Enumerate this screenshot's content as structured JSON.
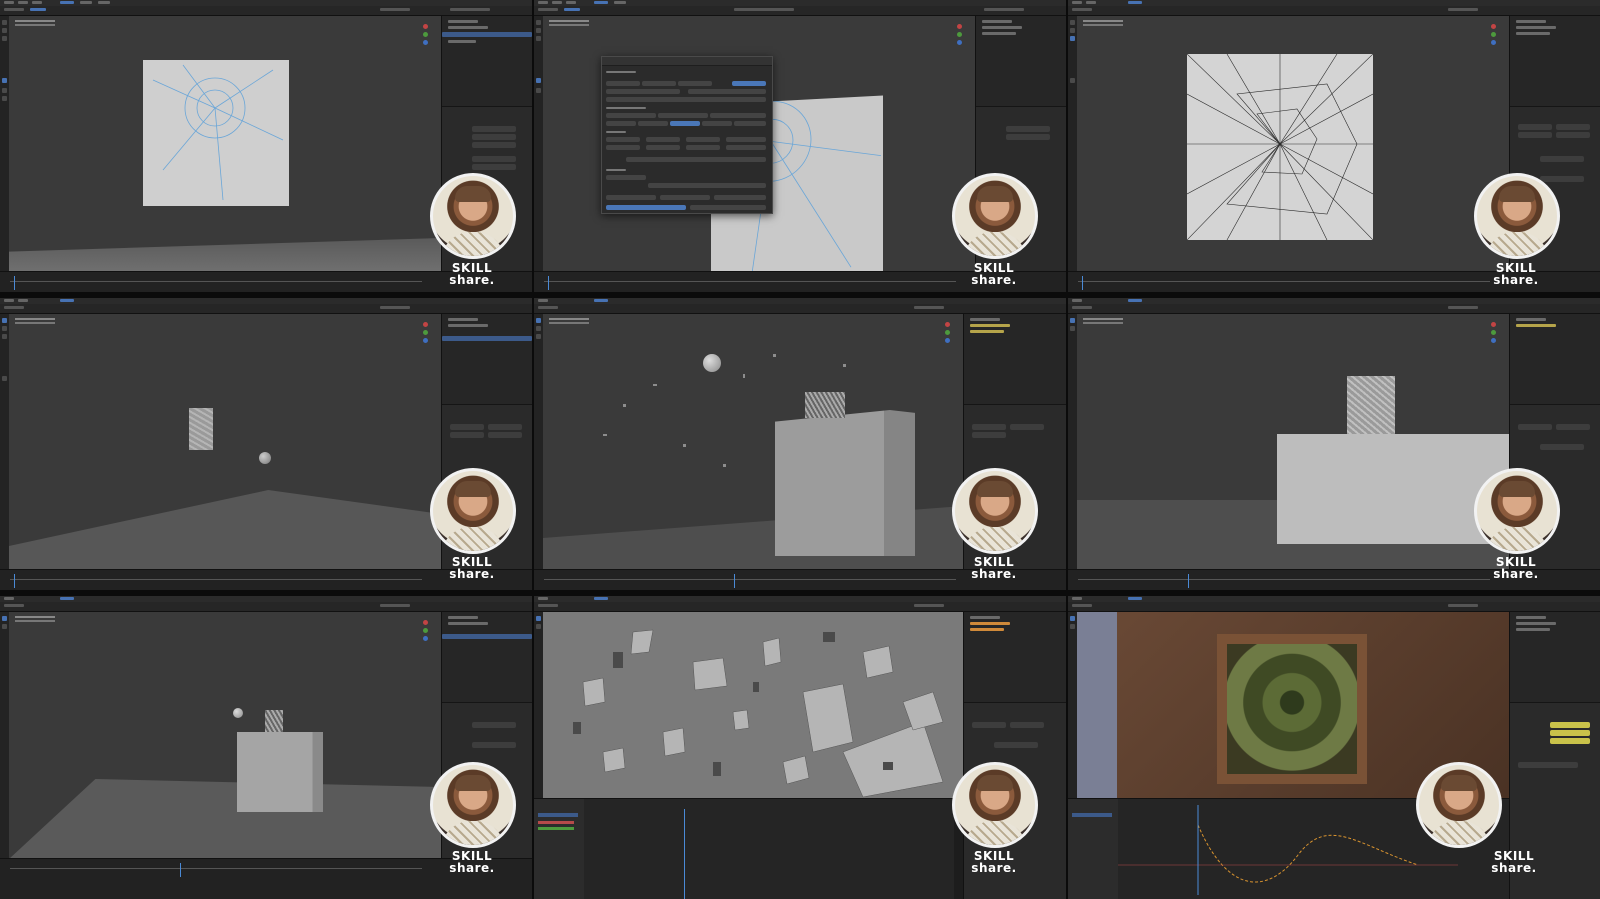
{
  "layout": {
    "columns": 3,
    "rows": 3
  },
  "brand": {
    "line1": "SKILL",
    "line2": "share."
  },
  "colors": {
    "viewport_bg": "#3a3a3a",
    "panel_bg": "#2a2a2a",
    "selection_blue": "#4772b3",
    "brand_text": "#ffffff",
    "avatar_ring": "#f2f2f2"
  },
  "tiles": [
    {
      "id": 1,
      "scene": "plane-with-blue-web-lines"
    },
    {
      "id": 2,
      "scene": "cell-fracture-dialog-over-plane"
    },
    {
      "id": 3,
      "scene": "plane-with-dense-fracture-lines"
    },
    {
      "id": 4,
      "scene": "small-panel-and-sphere-on-ground"
    },
    {
      "id": 5,
      "scene": "sphere-breaking-wall-debris"
    },
    {
      "id": 6,
      "scene": "fractured-panel-behind-wall"
    },
    {
      "id": 7,
      "scene": "debris-above-wall-wide-view"
    },
    {
      "id": 8,
      "scene": "close-up-debris-field-with-graph-editor"
    },
    {
      "id": 9,
      "scene": "rendered-frame-with-glass-shatter"
    }
  ]
}
